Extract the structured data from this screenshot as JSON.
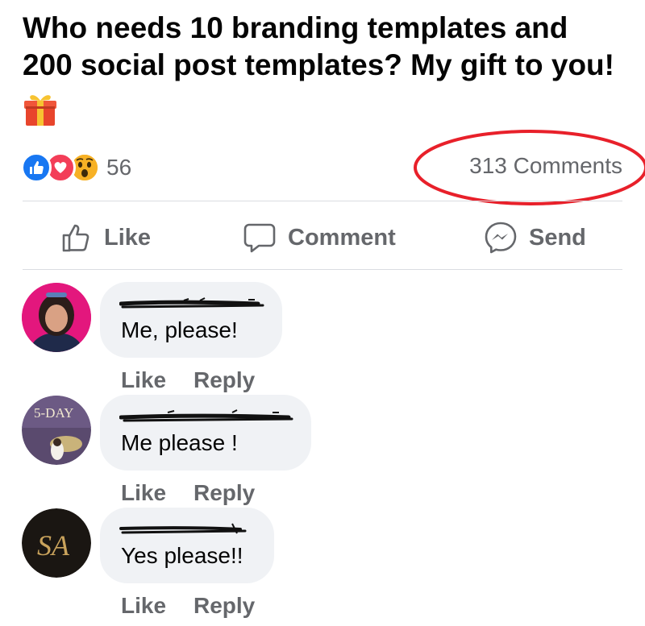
{
  "post": {
    "line1": "Who needs 10 branding templates and",
    "line2": "200 social post templates? My gift to you!",
    "emoji": "gift-emoji"
  },
  "reactions": {
    "types": [
      "like",
      "love",
      "wow"
    ],
    "count": "56"
  },
  "comments_count": "313 Comments",
  "colors": {
    "like": "#1877f2",
    "love": "#f33e58",
    "wow": "#f7b125",
    "secondary_text": "#65676b",
    "bubble": "#f0f2f5",
    "highlight": "#e8202a"
  },
  "actions": {
    "like": "Like",
    "comment": "Comment",
    "send": "Send"
  },
  "comments": [
    {
      "text": "Me, please!",
      "like": "Like",
      "reply": "Reply"
    },
    {
      "text": "Me please !",
      "like": "Like",
      "reply": "Reply"
    },
    {
      "text": "Yes please!!",
      "like": "Like",
      "reply": "Reply"
    }
  ],
  "avatars": {
    "second_badge": "5-DAY",
    "third_monogram": "SA"
  }
}
